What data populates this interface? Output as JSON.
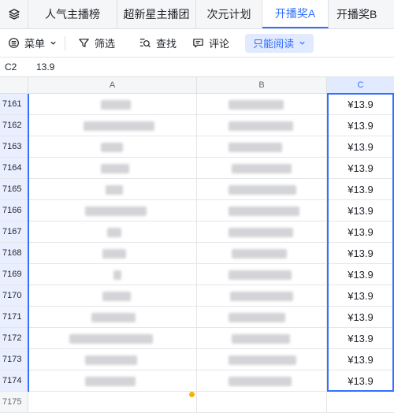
{
  "tabs": [
    {
      "label": "人气主播榜",
      "active": false
    },
    {
      "label": "超新星主播团",
      "active": false
    },
    {
      "label": "次元计划",
      "active": false
    },
    {
      "label": "开播奖A",
      "active": true
    },
    {
      "label": "开播奖B",
      "active": false
    }
  ],
  "toolbar": {
    "menu_label": "菜单",
    "filter_label": "筛选",
    "find_label": "查找",
    "comment_label": "评论",
    "readonly_label": "只能阅读"
  },
  "formula_bar": {
    "cell_ref": "C2",
    "value": "13.9"
  },
  "columns": [
    "A",
    "B",
    "C"
  ],
  "rows": [
    {
      "num": "7161",
      "c": "¥13.9"
    },
    {
      "num": "7162",
      "c": "¥13.9"
    },
    {
      "num": "7163",
      "c": "¥13.9"
    },
    {
      "num": "7164",
      "c": "¥13.9"
    },
    {
      "num": "7165",
      "c": "¥13.9"
    },
    {
      "num": "7166",
      "c": "¥13.9"
    },
    {
      "num": "7167",
      "c": "¥13.9"
    },
    {
      "num": "7168",
      "c": "¥13.9"
    },
    {
      "num": "7169",
      "c": "¥13.9"
    },
    {
      "num": "7170",
      "c": "¥13.9"
    },
    {
      "num": "7171",
      "c": "¥13.9"
    },
    {
      "num": "7172",
      "c": "¥13.9"
    },
    {
      "num": "7173",
      "c": "¥13.9"
    },
    {
      "num": "7174",
      "c": "¥13.9"
    },
    {
      "num": "7175",
      "c": ""
    }
  ],
  "colors": {
    "accent": "#3370ff",
    "selection_bg": "#e1eaff",
    "header_bg": "#f5f6f7",
    "gridline": "#e5e6e8"
  }
}
